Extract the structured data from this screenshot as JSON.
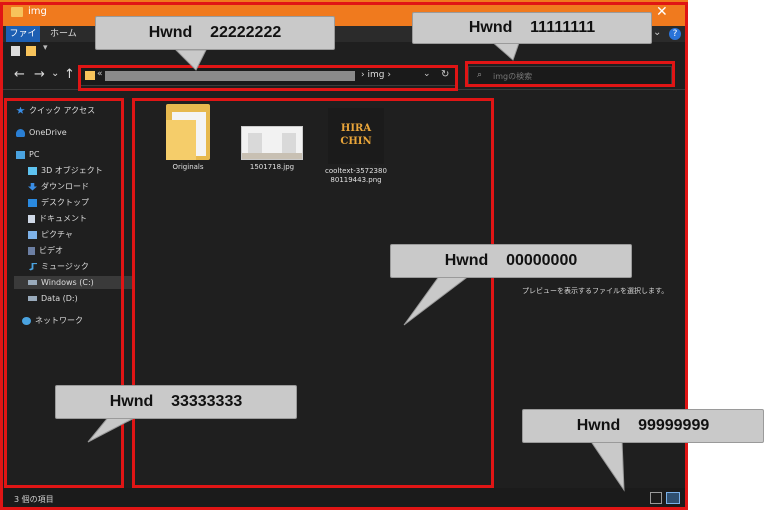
{
  "window": {
    "title": "img",
    "close_glyph": "✕",
    "accent_color": "#f07a1e"
  },
  "ribbon": {
    "file_tab": "ファイル",
    "home_tab": "ホーム",
    "expand_glyph": "⌄",
    "help_glyph": "?"
  },
  "qat": {
    "dropdown_glyph": "▾"
  },
  "nav": {
    "back": "←",
    "forward": "→",
    "recent": "⌄",
    "up": "↑",
    "address_prefix": "«",
    "address_sep": "›",
    "address_current": "img",
    "address_dd": "⌄",
    "refresh": "↻",
    "search_icon": "⌕",
    "search_placeholder": "imgの検索"
  },
  "sidebar": {
    "items": [
      {
        "label": "クイック アクセス",
        "icon": "star-icon",
        "color": "#3a8ee6"
      },
      {
        "label": "OneDrive",
        "icon": "cloud-icon",
        "color": "#2a7fd4"
      },
      {
        "label": "PC",
        "icon": "pc-icon",
        "color": "#4aa3e0"
      },
      {
        "label": "3D オブジェクト",
        "icon": "cube-icon",
        "color": "#5ec3f0"
      },
      {
        "label": "ダウンロード",
        "icon": "download-icon",
        "color": "#3a8ee6"
      },
      {
        "label": "デスクトップ",
        "icon": "desktop-icon",
        "color": "#2a8ae0"
      },
      {
        "label": "ドキュメント",
        "icon": "document-icon",
        "color": "#cfd8e6"
      },
      {
        "label": "ピクチャ",
        "icon": "pictures-icon",
        "color": "#7db2e8"
      },
      {
        "label": "ビデオ",
        "icon": "video-icon",
        "color": "#6c7fa3"
      },
      {
        "label": "ミュージック",
        "icon": "music-icon",
        "color": "#4aa3e0"
      },
      {
        "label": "Windows (C:)",
        "icon": "drive-icon",
        "color": "#9ab"
      },
      {
        "label": "Data (D:)",
        "icon": "drive-icon",
        "color": "#9ab"
      },
      {
        "label": "ネットワーク",
        "icon": "network-icon",
        "color": "#4aa3e0"
      }
    ]
  },
  "files": [
    {
      "name": "Originals",
      "kind": "folder"
    },
    {
      "name": "1501718.jpg",
      "kind": "image"
    },
    {
      "name": "cooltext-357238080119443.png",
      "line1": "cooltext-3572380",
      "line2": "80119443.png",
      "kind": "image"
    }
  ],
  "logo_thumb": {
    "line1": "HIRA",
    "line2": "CHIN"
  },
  "preview_message": "プレビューを表示するファイルを選択します。",
  "status": {
    "count": "3 個の項目"
  },
  "callouts": {
    "address": "Hwnd    22222222",
    "search": "Hwnd    11111111",
    "content": "Hwnd    00000000",
    "sidebar": "Hwnd    33333333",
    "statusbar": "Hwnd    99999999"
  },
  "colors": {
    "highlight_red": "#e01515",
    "callout_gray": "#c9c9c9"
  }
}
